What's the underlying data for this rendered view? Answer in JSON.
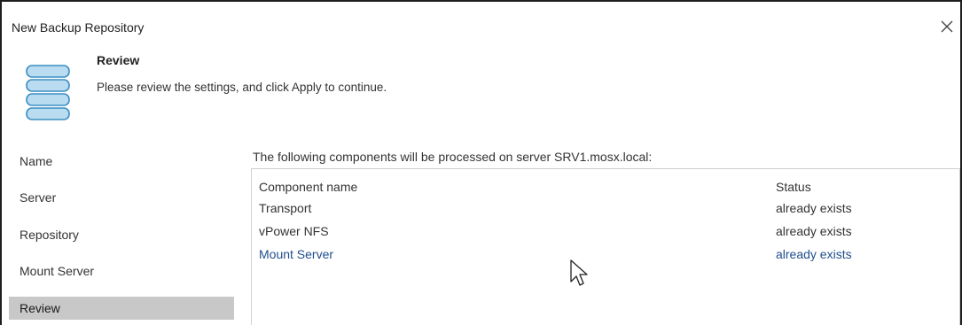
{
  "window": {
    "title": "New Backup Repository",
    "close_label": "×"
  },
  "header": {
    "title": "Review",
    "description": "Please review the settings, and click Apply to continue.",
    "icon": "database-icon"
  },
  "nav": {
    "items": [
      {
        "label": "Name"
      },
      {
        "label": "Server"
      },
      {
        "label": "Repository"
      },
      {
        "label": "Mount Server"
      },
      {
        "label": "Review",
        "selected": true
      }
    ]
  },
  "main": {
    "intro": "The following components will be processed on server SRV1.mosx.local:",
    "table": {
      "columns": [
        "Component name",
        "Status"
      ],
      "rows": [
        {
          "name": "Transport",
          "status": "already exists"
        },
        {
          "name": "vPower NFS",
          "status": "already exists"
        },
        {
          "name": "Mount Server",
          "status": "already exists",
          "highlighted": true
        }
      ]
    }
  },
  "colors": {
    "selected_nav_bg": "#c8c8c8",
    "highlight_text": "#1f4e8c",
    "icon_fill": "#b9dcf0",
    "icon_stroke": "#3c8fc4"
  }
}
